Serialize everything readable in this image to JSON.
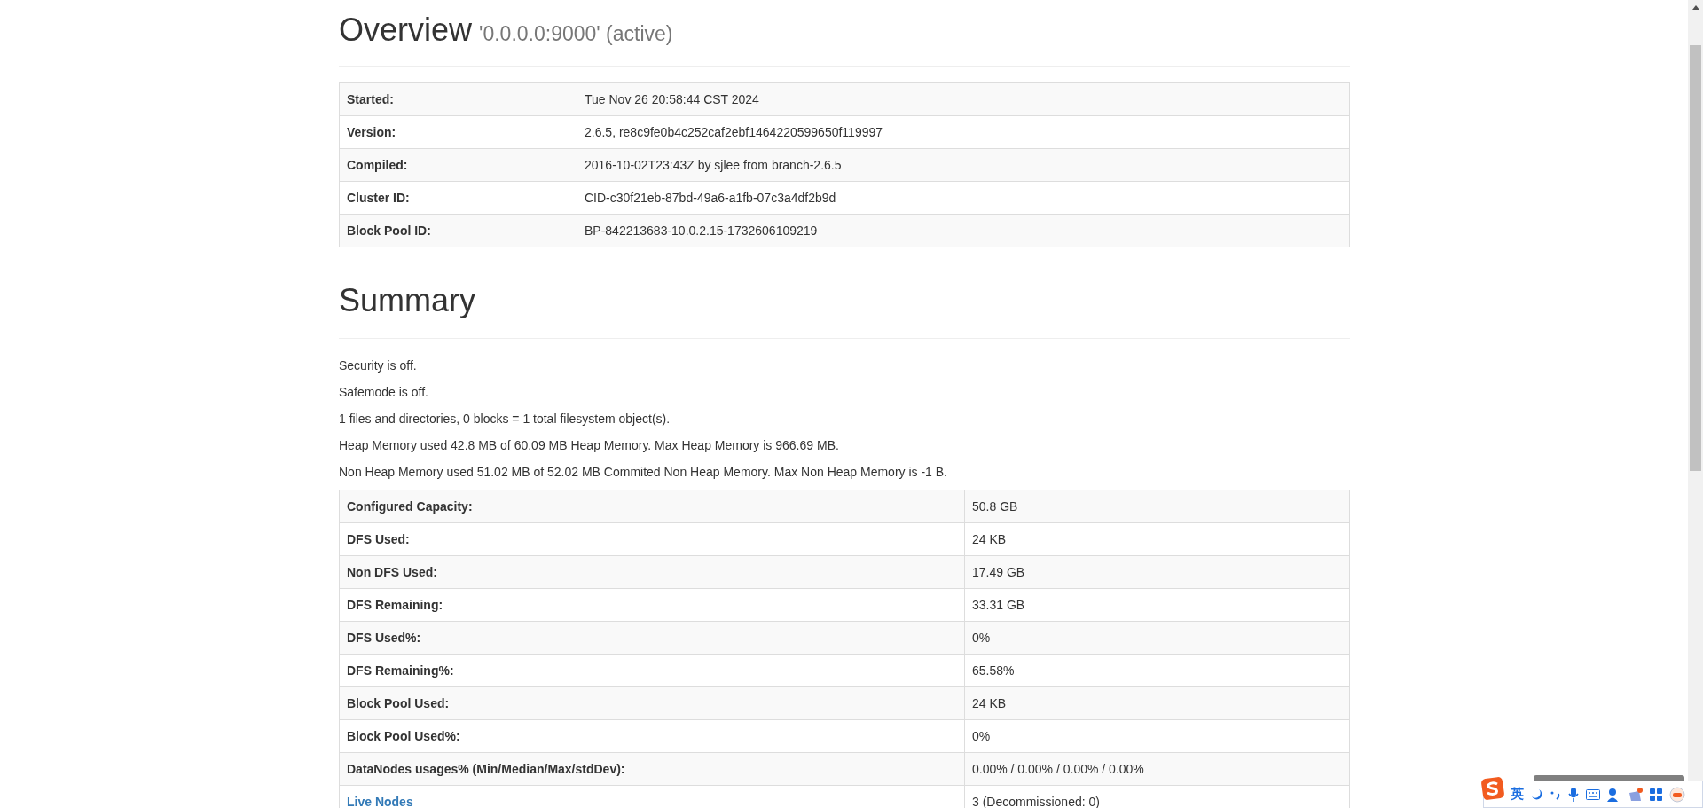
{
  "overview": {
    "title": "Overview",
    "subtitle": "'0.0.0.0:9000' (active)",
    "rows": [
      {
        "label": "Started:",
        "value": "Tue Nov 26 20:58:44 CST 2024"
      },
      {
        "label": "Version:",
        "value": "2.6.5, re8c9fe0b4c252caf2ebf1464220599650f119997"
      },
      {
        "label": "Compiled:",
        "value": "2016-10-02T23:43Z by sjlee from branch-2.6.5"
      },
      {
        "label": "Cluster ID:",
        "value": "CID-c30f21eb-87bd-49a6-a1fb-07c3a4df2b9d"
      },
      {
        "label": "Block Pool ID:",
        "value": "BP-842213683-10.0.2.15-1732606109219"
      }
    ]
  },
  "summary": {
    "title": "Summary",
    "lines": [
      "Security is off.",
      "Safemode is off.",
      "1 files and directories, 0 blocks = 1 total filesystem object(s).",
      "Heap Memory used 42.8 MB of 60.09 MB Heap Memory. Max Heap Memory is 966.69 MB.",
      "Non Heap Memory used 51.02 MB of 52.02 MB Commited Non Heap Memory. Max Non Heap Memory is -1 B."
    ],
    "rows": [
      {
        "kind": "text",
        "label": "Configured Capacity:",
        "value": "50.8 GB"
      },
      {
        "kind": "text",
        "label": "DFS Used:",
        "value": "24 KB"
      },
      {
        "kind": "text",
        "label": "Non DFS Used:",
        "value": "17.49 GB"
      },
      {
        "kind": "text",
        "label": "DFS Remaining:",
        "value": "33.31 GB"
      },
      {
        "kind": "text",
        "label": "DFS Used%:",
        "value": "0%"
      },
      {
        "kind": "text",
        "label": "DFS Remaining%:",
        "value": "65.58%"
      },
      {
        "kind": "text",
        "label": "Block Pool Used:",
        "value": "24 KB"
      },
      {
        "kind": "text",
        "label": "Block Pool Used%:",
        "value": "0%"
      },
      {
        "kind": "text",
        "label": "DataNodes usages% (Min/Median/Max/stdDev):",
        "value": "0.00% / 0.00% / 0.00% / 0.00%"
      },
      {
        "kind": "link",
        "label": "Live Nodes",
        "value": "3 (Decommissioned: 0)"
      }
    ]
  },
  "ime_toolbar": {
    "language": "英"
  }
}
